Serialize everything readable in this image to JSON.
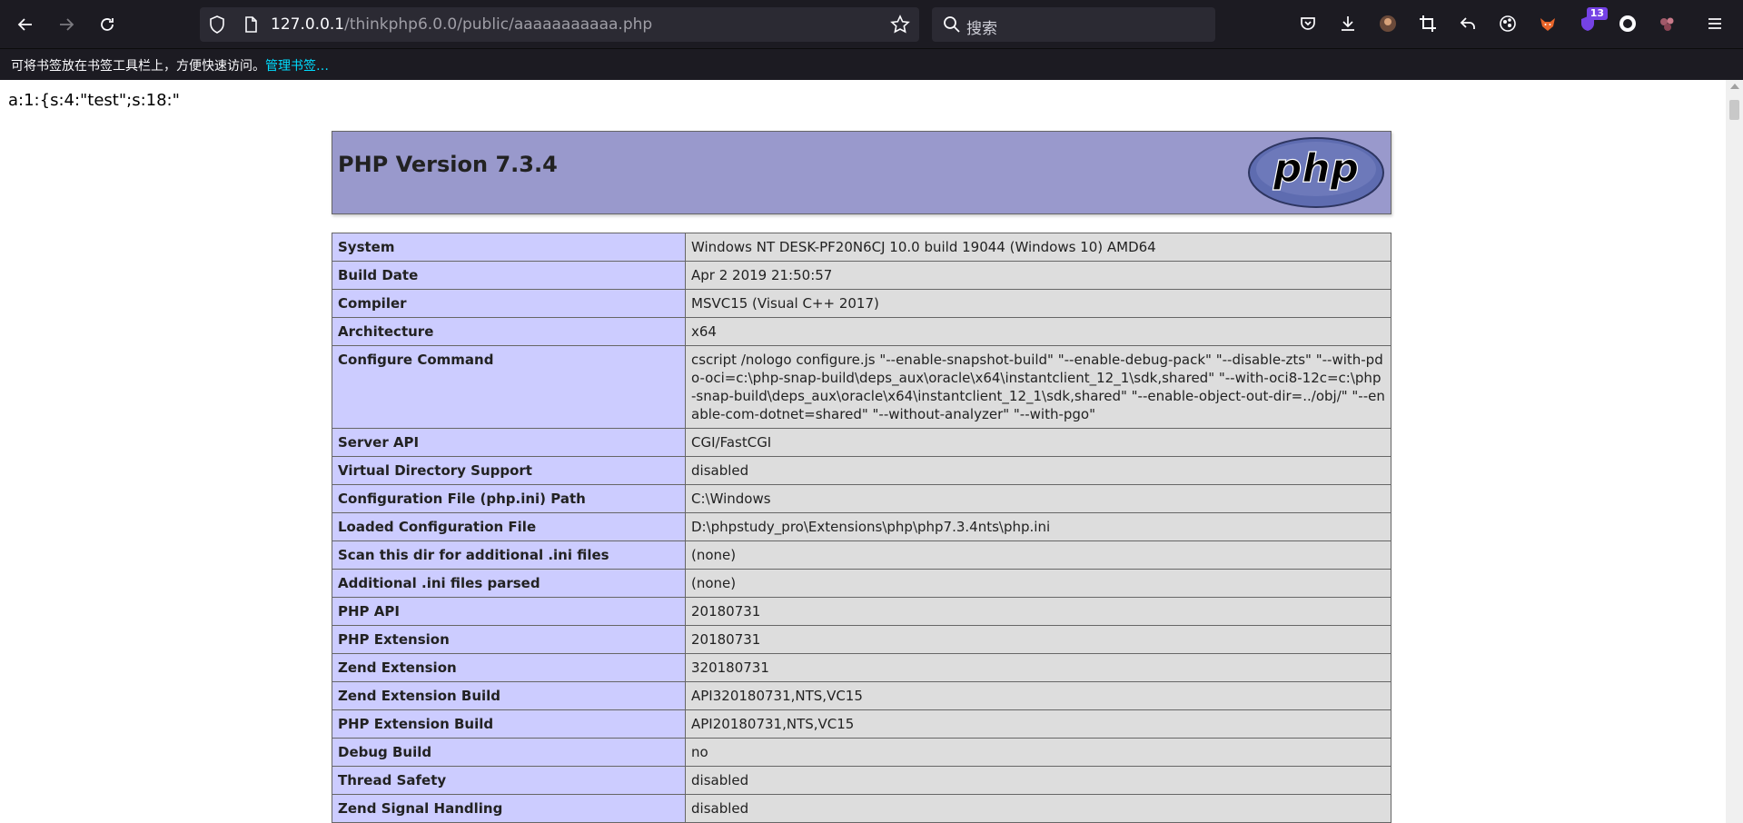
{
  "browser": {
    "url_host": "127.0.0.1",
    "url_path": "/thinkphp6.0.0/public/aaaaaaaaaaa.php",
    "search_placeholder": "搜索",
    "extension_badge": "13",
    "bookmarks_message": "可将书签放在书签工具栏上，方便快速访问。",
    "bookmarks_link": "管理书签…"
  },
  "page": {
    "serialized_output": "a:1:{s:4:\"test\";s:18:\"",
    "php_title": "PHP Version 7.3.4",
    "php_logo_text": "php",
    "rows": [
      {
        "key": "System",
        "value": "Windows NT DESK-PF20N6CJ 10.0 build 19044 (Windows 10) AMD64"
      },
      {
        "key": "Build Date",
        "value": "Apr 2 2019 21:50:57"
      },
      {
        "key": "Compiler",
        "value": "MSVC15 (Visual C++ 2017)"
      },
      {
        "key": "Architecture",
        "value": "x64"
      },
      {
        "key": "Configure Command",
        "value": "cscript /nologo configure.js \"--enable-snapshot-build\" \"--enable-debug-pack\" \"--disable-zts\" \"--with-pdo-oci=c:\\php-snap-build\\deps_aux\\oracle\\x64\\instantclient_12_1\\sdk,shared\" \"--with-oci8-12c=c:\\php-snap-build\\deps_aux\\oracle\\x64\\instantclient_12_1\\sdk,shared\" \"--enable-object-out-dir=../obj/\" \"--enable-com-dotnet=shared\" \"--without-analyzer\" \"--with-pgo\""
      },
      {
        "key": "Server API",
        "value": "CGI/FastCGI"
      },
      {
        "key": "Virtual Directory Support",
        "value": "disabled"
      },
      {
        "key": "Configuration File (php.ini) Path",
        "value": "C:\\Windows"
      },
      {
        "key": "Loaded Configuration File",
        "value": "D:\\phpstudy_pro\\Extensions\\php\\php7.3.4nts\\php.ini"
      },
      {
        "key": "Scan this dir for additional .ini files",
        "value": "(none)"
      },
      {
        "key": "Additional .ini files parsed",
        "value": "(none)"
      },
      {
        "key": "PHP API",
        "value": "20180731"
      },
      {
        "key": "PHP Extension",
        "value": "20180731"
      },
      {
        "key": "Zend Extension",
        "value": "320180731"
      },
      {
        "key": "Zend Extension Build",
        "value": "API320180731,NTS,VC15"
      },
      {
        "key": "PHP Extension Build",
        "value": "API20180731,NTS,VC15"
      },
      {
        "key": "Debug Build",
        "value": "no"
      },
      {
        "key": "Thread Safety",
        "value": "disabled"
      },
      {
        "key": "Zend Signal Handling",
        "value": "disabled"
      }
    ]
  },
  "colors": {
    "chrome_bg": "#1c1b22",
    "field_bg": "#2b2a33",
    "header_bg": "#9999cc",
    "key_bg": "#ccccff",
    "value_bg": "#dddddd",
    "link": "#00ddff"
  }
}
